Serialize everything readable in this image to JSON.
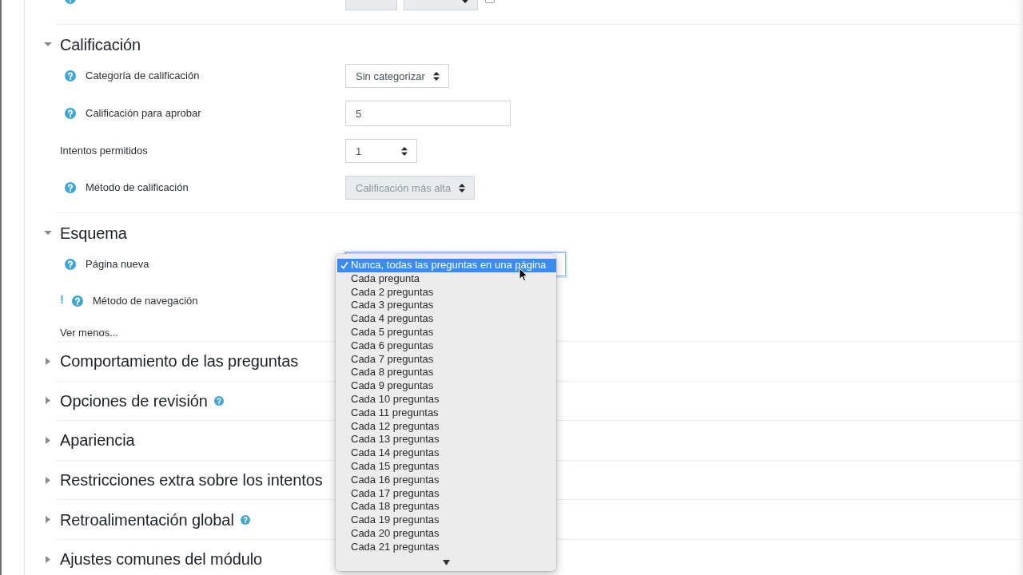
{
  "cut_off_row": {
    "help": true,
    "disabled": true,
    "checkbox": {
      "checked": false
    }
  },
  "sections": [
    {
      "title": "Calificación",
      "expanded": true,
      "help": false,
      "rows": [
        {
          "label": "Categoría de calificación",
          "help": true,
          "kind": "select",
          "value": "Sin categorizar",
          "disabled": false
        },
        {
          "label": "Calificación para aprobar",
          "help": true,
          "kind": "text",
          "value": "5",
          "disabled": false
        },
        {
          "label": "Intentos permitidos",
          "help": false,
          "kind": "select",
          "value": "1",
          "disabled": false
        },
        {
          "label": "Método de calificación",
          "help": true,
          "kind": "select",
          "value": "Calificación más alta",
          "disabled": true
        }
      ]
    },
    {
      "title": "Esquema",
      "expanded": true,
      "help": false,
      "rows": [
        {
          "label": "Página nueva",
          "help": true,
          "kind": "select",
          "disabled": false,
          "open": true,
          "options": [
            {
              "label": "Nunca, todas las preguntas en una página",
              "selected": true
            },
            {
              "label": "Cada pregunta",
              "selected": false
            },
            {
              "label": "Cada 2 preguntas",
              "selected": false
            },
            {
              "label": "Cada 3 preguntas",
              "selected": false
            },
            {
              "label": "Cada 4 preguntas",
              "selected": false
            },
            {
              "label": "Cada 5 preguntas",
              "selected": false
            },
            {
              "label": "Cada 6 preguntas",
              "selected": false
            },
            {
              "label": "Cada 7 preguntas",
              "selected": false
            },
            {
              "label": "Cada 8 preguntas",
              "selected": false
            },
            {
              "label": "Cada 9 preguntas",
              "selected": false
            },
            {
              "label": "Cada 10 preguntas",
              "selected": false
            },
            {
              "label": "Cada 11 preguntas",
              "selected": false
            },
            {
              "label": "Cada 12 preguntas",
              "selected": false
            },
            {
              "label": "Cada 13 preguntas",
              "selected": false
            },
            {
              "label": "Cada 14 preguntas",
              "selected": false
            },
            {
              "label": "Cada 15 preguntas",
              "selected": false
            },
            {
              "label": "Cada 16 preguntas",
              "selected": false
            },
            {
              "label": "Cada 17 preguntas",
              "selected": false
            },
            {
              "label": "Cada 18 preguntas",
              "selected": false
            },
            {
              "label": "Cada 19 preguntas",
              "selected": false
            },
            {
              "label": "Cada 20 preguntas",
              "selected": false
            },
            {
              "label": "Cada 21 preguntas",
              "selected": false
            }
          ]
        },
        {
          "label": "Método de navegación",
          "help": true,
          "marker": "!"
        }
      ],
      "link": "Ver menos..."
    },
    {
      "title": "Comportamiento de las preguntas",
      "expanded": false,
      "help": false
    },
    {
      "title": "Opciones de revisión",
      "expanded": false,
      "help": true
    },
    {
      "title": "Apariencia",
      "expanded": false,
      "help": false
    },
    {
      "title": "Restricciones extra sobre los intentos",
      "expanded": false,
      "help": false
    },
    {
      "title": "Retroalimentación global",
      "expanded": false,
      "help": true
    },
    {
      "title": "Ajustes comunes del módulo",
      "expanded": false,
      "help": false
    }
  ]
}
